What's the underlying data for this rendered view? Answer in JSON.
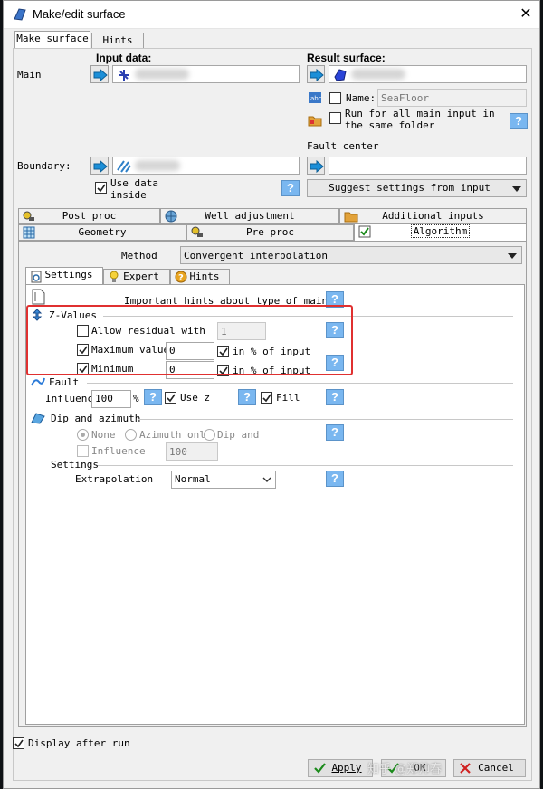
{
  "window": {
    "title": "Make/edit surface"
  },
  "top_tabs": [
    "Make surface",
    "Hints"
  ],
  "input": {
    "main_label": "Main",
    "input_data_header": "Input data:",
    "boundary_label": "Boundary:",
    "use_data_inside": "Use data inside"
  },
  "result": {
    "header": "Result surface:",
    "name_label": "Name:",
    "name_value": "SeaFloor",
    "run_all": "Run for all main input in the same folder",
    "fault_center": "Fault center",
    "suggest_button": "Suggest settings from input"
  },
  "proc_tabs": {
    "row1": [
      "Post proc",
      "Well adjustment",
      "Additional inputs"
    ],
    "row2": [
      "Geometry",
      "Pre proc",
      "Algorithm"
    ]
  },
  "method": {
    "label": "Method",
    "value": "Convergent interpolation"
  },
  "sub_tabs": [
    "Settings",
    "Expert",
    "Hints"
  ],
  "hints_row": "Important hints about type of main",
  "zvalues": {
    "header": "Z-Values",
    "allow_residual": "Allow residual with",
    "allow_residual_value": "1",
    "max_label": "Maximum value:",
    "max_value": "0",
    "min_label": "Minimum",
    "min_value": "0",
    "pct_label": "in % of input"
  },
  "fault": {
    "header": "Fault",
    "influence_label": "Influence",
    "influence_value": "100",
    "pct": "%",
    "use_z": "Use z",
    "fill": "Fill"
  },
  "dip": {
    "header": "Dip and azimuth",
    "none": "None",
    "azimuth_only": "Azimuth only",
    "dip_and": "Dip and",
    "influence_label": "Influence",
    "influence_value": "100"
  },
  "settings": {
    "header": "Settings",
    "extrapolation_label": "Extrapolation",
    "extrapolation_value": "Normal"
  },
  "footer": {
    "display_after_run": "Display after run",
    "apply": "Apply",
    "ok": "OK",
    "cancel": "Cancel"
  },
  "help_glyph": "?",
  "close_glyph": "✕",
  "watermark": "知乎 @郑帅春",
  "colors": {
    "accent_help": "#7ab7f0",
    "highlight_box": "#e03030",
    "check_green": "#1a8a1a"
  }
}
